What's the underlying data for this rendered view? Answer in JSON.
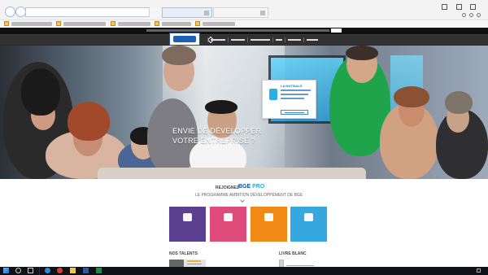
{
  "browser": {
    "address_text": "",
    "tabs": [
      {
        "label": "",
        "active": true
      },
      {
        "label": "",
        "active": false
      }
    ],
    "favorites": [
      ""
    ]
  },
  "header": {
    "nav_items": [
      "",
      "",
      "",
      "",
      "",
      ""
    ]
  },
  "hero": {
    "title_line_1": "ENVIE DE DÉVELOPPER",
    "title_line_2": "VOTRE ENTREPRISE ?",
    "card": {
      "title": "LA MATINALE"
    }
  },
  "section": {
    "rejoignez": "REJOIGNEZ",
    "brand_left": "BGE",
    "brand_right": "PRO",
    "program_line": "LE PROGRAMME AMBITION DÉVELOPPEMENT DE BGE",
    "tiles": [
      {
        "label": "",
        "color": "#5b3f91"
      },
      {
        "label": "",
        "color": "#df4c7c"
      },
      {
        "label": "",
        "color": "#f08a14"
      },
      {
        "label": "",
        "color": "#36a8df"
      }
    ],
    "talents_heading": "NOS TALENTS",
    "livre_blanc_heading": "LIVRE BLANC",
    "livre_blanc_item": ""
  },
  "taskbar": {
    "time": "",
    "date": ""
  },
  "colors": {
    "dark_header": "#313132",
    "bge_blue": "#1a4ea8",
    "accent_cyan": "#29aae1",
    "tile_purple": "#5b3f91",
    "tile_pink": "#df4c7c",
    "tile_orange": "#f08a14",
    "tile_blue": "#36a8df"
  },
  "icons": {
    "home": "home-icon",
    "back": "back-icon",
    "forward": "forward-icon",
    "minimize": "minimize-icon",
    "maximize": "maximize-icon",
    "close": "close-icon",
    "search": "search-icon",
    "windows_start": "windows-start-icon"
  }
}
